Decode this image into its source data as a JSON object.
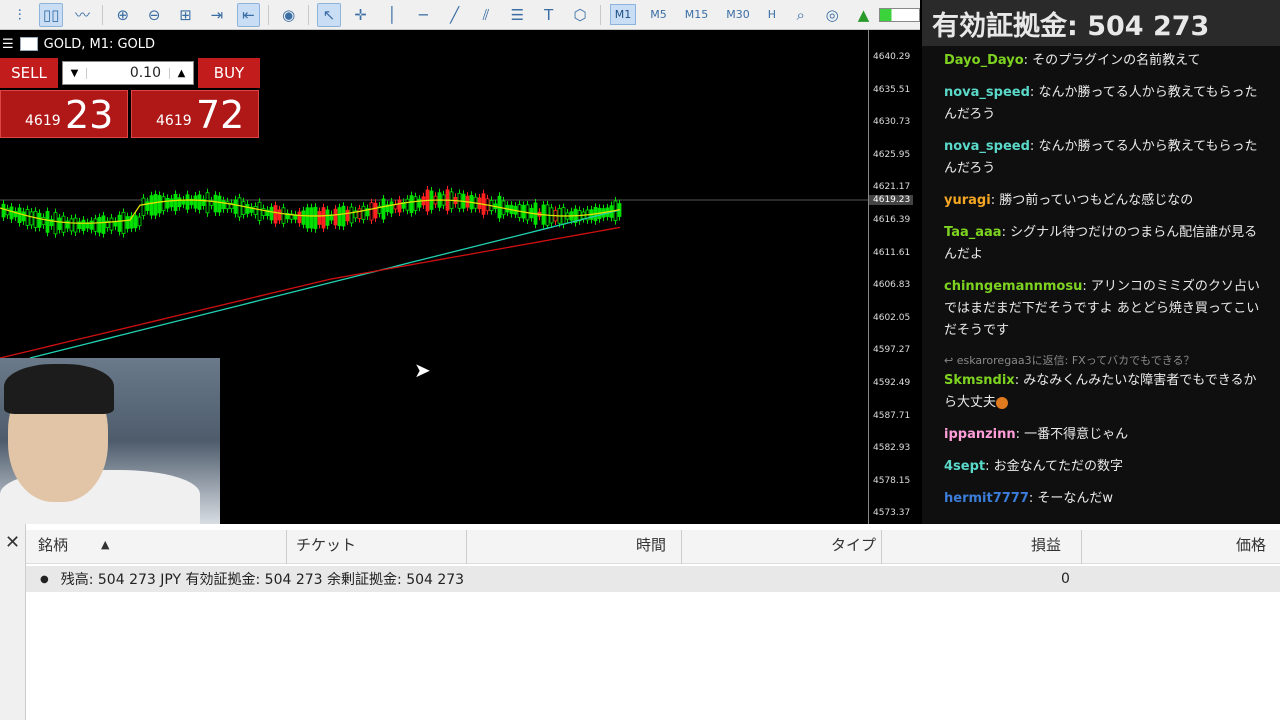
{
  "toolbar": {
    "timeframes": [
      {
        "label": "M1",
        "selected": true
      },
      {
        "label": "M5",
        "selected": false
      },
      {
        "label": "M15",
        "selected": false
      },
      {
        "label": "M30",
        "selected": false
      },
      {
        "label": "H",
        "selected": false
      }
    ]
  },
  "equity_overlay": "有効証拠金: 504 273",
  "chart": {
    "title": "GOLD, M1: GOLD",
    "one_click": {
      "sell_label": "SELL",
      "buy_label": "BUY",
      "lot": "0.10",
      "sell_small": "4619",
      "sell_big": "23",
      "buy_small": "4619",
      "buy_big": "72"
    },
    "axis_labels": [
      "4640.29",
      "4635.51",
      "4630.73",
      "4625.95",
      "4621.17",
      "4616.39",
      "4611.61",
      "4606.83",
      "4602.05",
      "4597.27",
      "4592.49",
      "4587.71",
      "4582.93",
      "4578.15",
      "4573.37"
    ],
    "current_price": "4619.23",
    "colors": {
      "bull": "#00e000",
      "bear": "#ff2020",
      "ma_fast": "#e0e000",
      "ma_mid": "#d01010",
      "ma_slow": "#20d0b0"
    }
  },
  "chat": {
    "messages": [
      {
        "user": "Dayo_Dayo",
        "color": "#7ed321",
        "text": "そのプラグインの名前教えて"
      },
      {
        "user": "nova_speed",
        "color": "#5ad9c9",
        "text": "なんか勝ってる人から教えてもらったんだろう"
      },
      {
        "user": "nova_speed",
        "color": "#5ad9c9",
        "text": "なんか勝ってる人から教えてもらったんだろう"
      },
      {
        "user": "yuragi",
        "color": "#f5a623",
        "text": "勝つ前っていつもどんな感じなの"
      },
      {
        "user": "Taa_aaa",
        "color": "#7ed321",
        "text": "シグナル待つだけのつまらん配信誰が見るんだよ"
      },
      {
        "user": "chinngemannmosu",
        "color": "#7ed321",
        "text": "アリンコのミミズのクソ占いではまだまだ下だそうですよ あとどら焼き買ってこいだそうです"
      },
      {
        "reply_to": "eskaroregaa3に返信: FXってバカでもできる？",
        "user": "Skmsndix",
        "color": "#7ed321",
        "text": "みなみくんみたいな障害者でもできるから大丈夫"
      },
      {
        "user": "ippanzinn",
        "color": "#ff9ed8",
        "text": "一番不得意じゃん"
      },
      {
        "user": "4sept",
        "color": "#5ad9c9",
        "text": "お金なんてただの数字"
      },
      {
        "user": "hermit7777",
        "color": "#3b7dd8",
        "text": "そーなんだw"
      }
    ]
  },
  "terminal": {
    "columns": [
      "銘柄",
      "チケット",
      "時間",
      "タイプ",
      "損益",
      "価格"
    ],
    "balance_row": "残高: 504 273 JPY  有効証拠金: 504 273  余剰証拠金: 504 273",
    "balance_value": "0"
  }
}
